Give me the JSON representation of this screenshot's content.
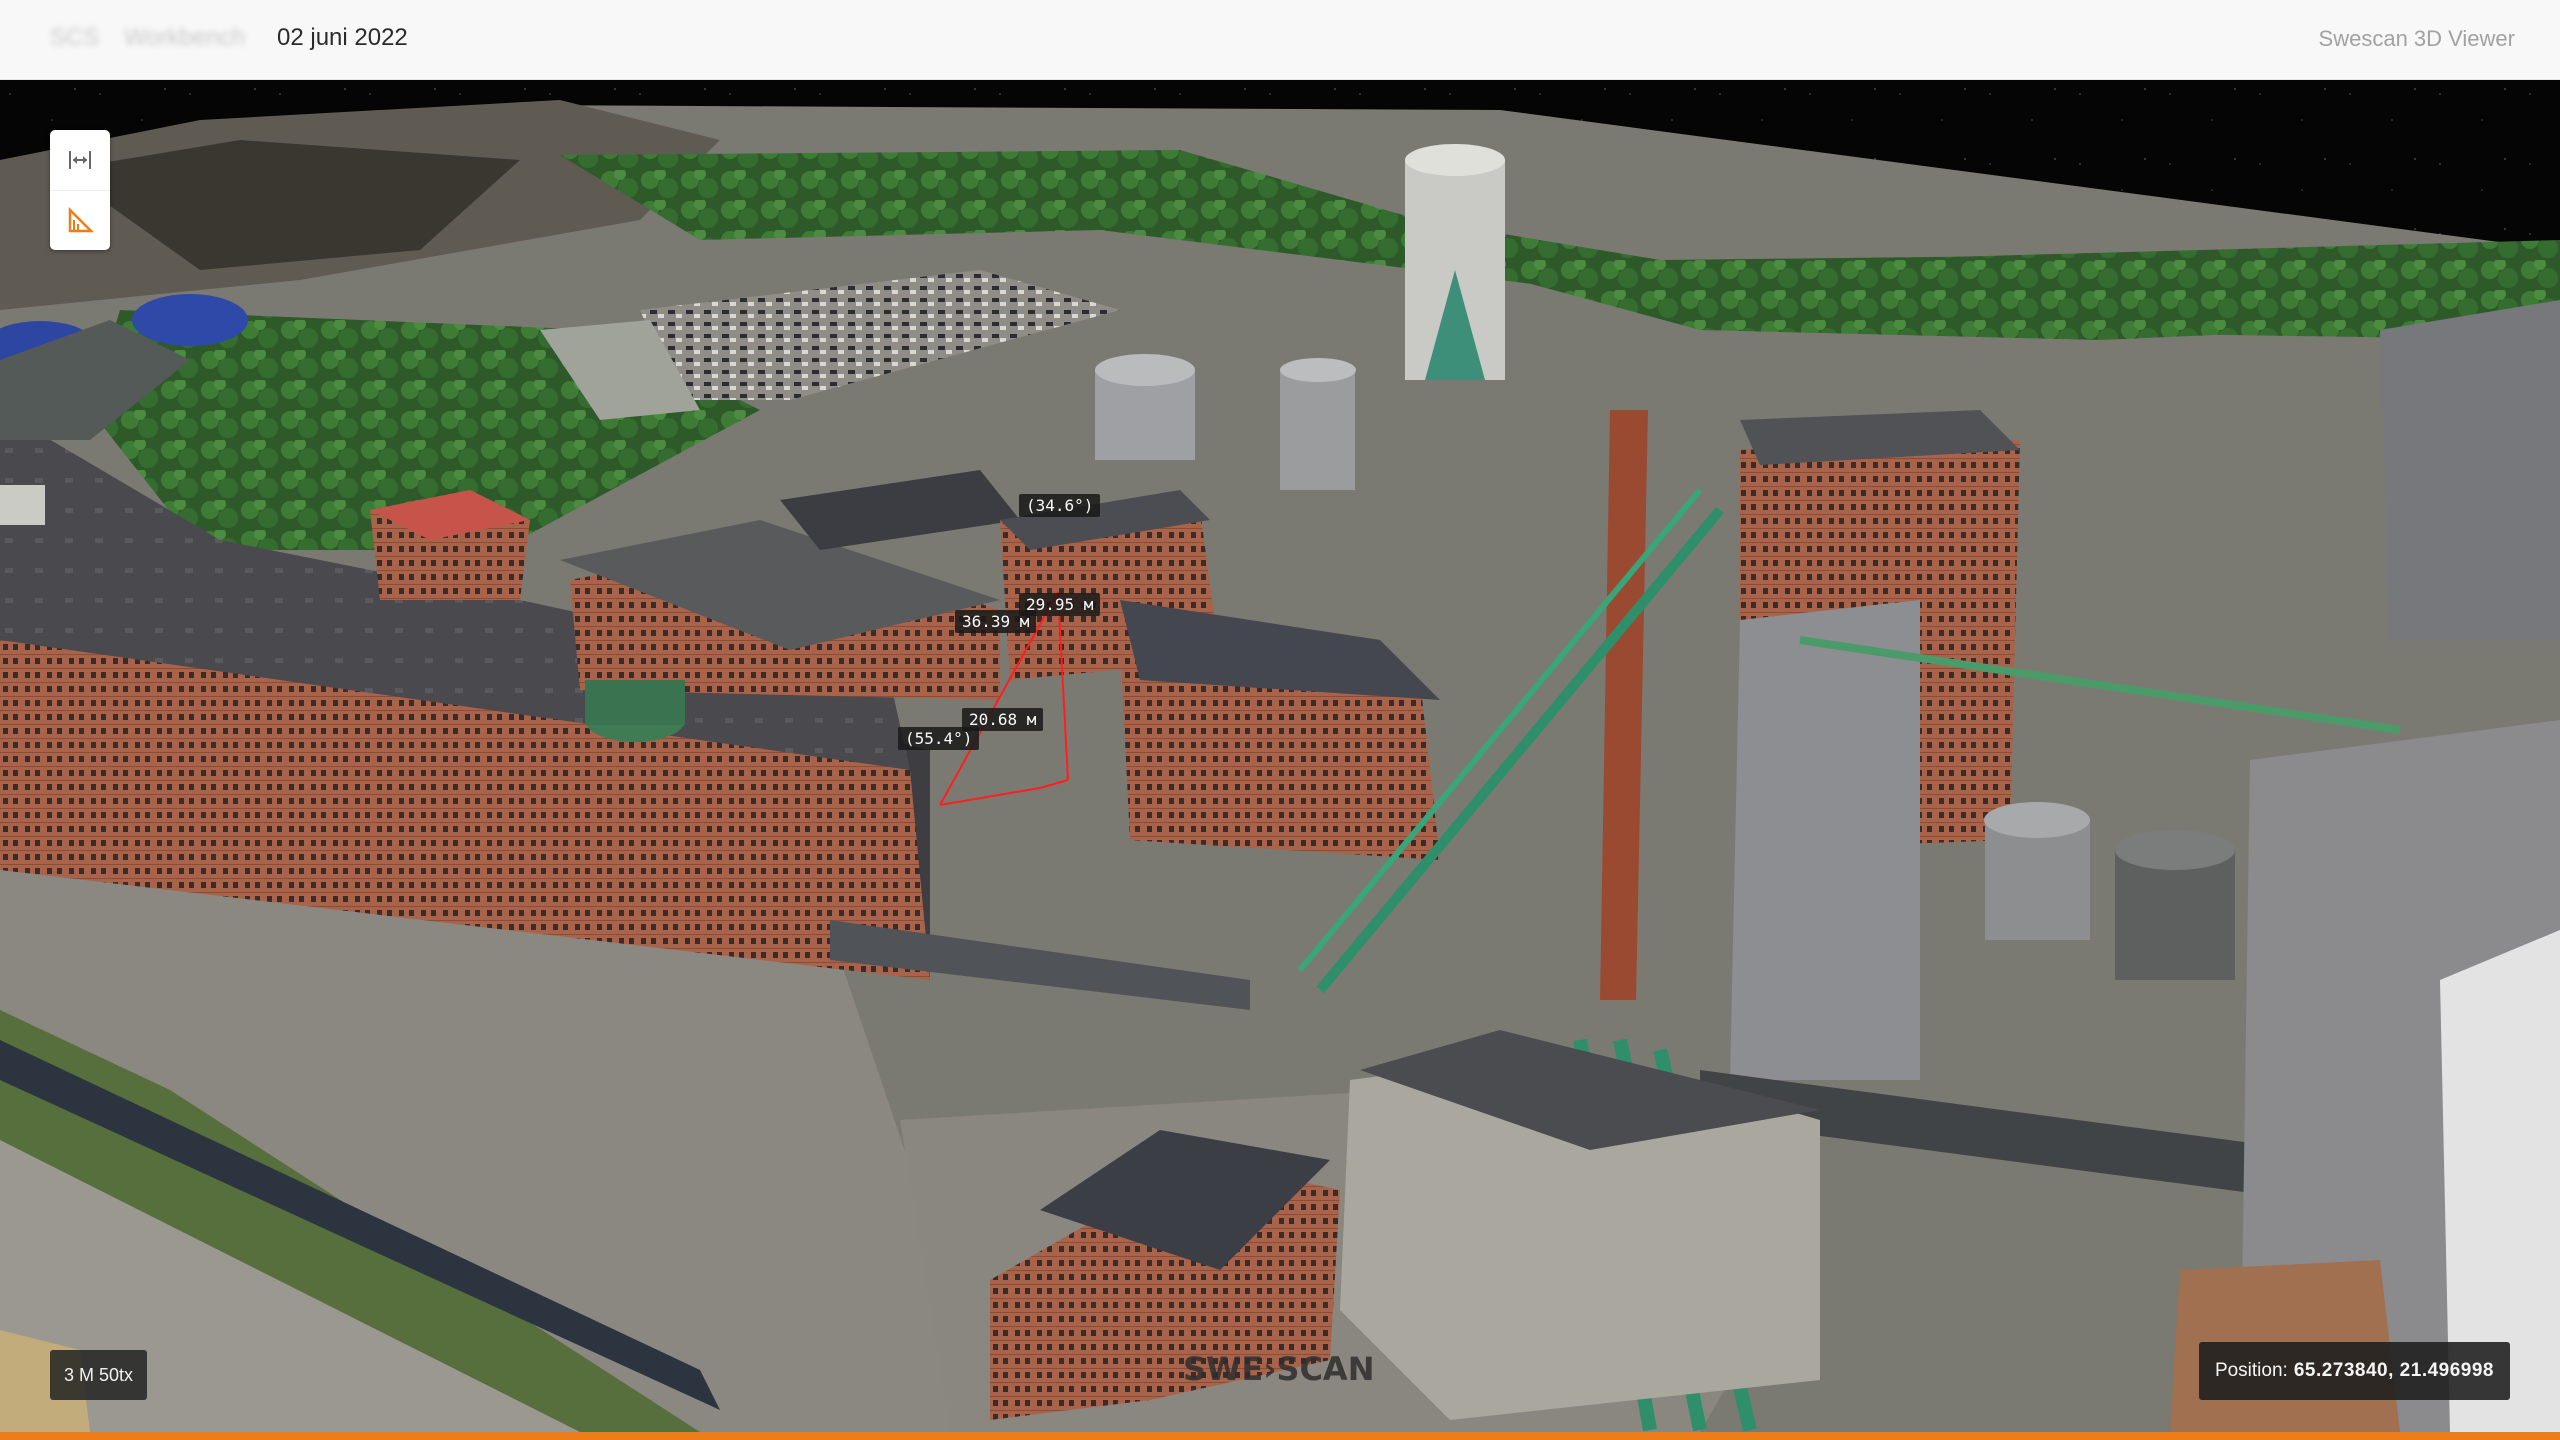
{
  "header": {
    "breadcrumb": [
      "SCS",
      "Workbench"
    ],
    "date": "02 juni 2022",
    "app_title": "Swescan 3D Viewer"
  },
  "toolbar": {
    "buttons": [
      {
        "icon": "distance-measure-icon",
        "tooltip": ""
      },
      {
        "icon": "angle-measure-icon",
        "tooltip": ""
      }
    ],
    "accent_color": "#ee7d18"
  },
  "measurement": {
    "labels": [
      "(34.6°)",
      "29.95 м",
      "36.39 м",
      "20.68 м",
      "(55.4°)"
    ],
    "line_color": "#ff1e1e"
  },
  "scale": {
    "text": "3 M 50tx"
  },
  "position": {
    "label": "Position:",
    "value": "65.273840, 21.496998"
  },
  "watermark": {
    "text": "SWE›SCAN"
  },
  "progress": {
    "fraction": 1.0,
    "color": "#ee7d18"
  }
}
